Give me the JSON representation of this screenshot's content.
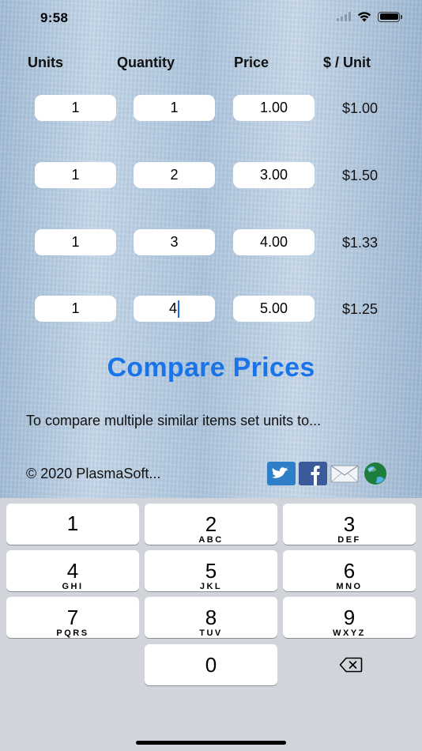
{
  "status_bar": {
    "time": "9:58"
  },
  "headers": {
    "units": "Units",
    "quantity": "Quantity",
    "price": "Price",
    "per_unit": "$ / Unit"
  },
  "rows": [
    {
      "units": "1",
      "quantity": "1",
      "price": "1.00",
      "per_unit": "$1.00"
    },
    {
      "units": "1",
      "quantity": "2",
      "price": "3.00",
      "per_unit": "$1.50"
    },
    {
      "units": "1",
      "quantity": "3",
      "price": "4.00",
      "per_unit": "$1.33"
    },
    {
      "units": "1",
      "quantity": "4",
      "price": "5.00",
      "per_unit": "$1.25"
    }
  ],
  "compare_button": "Compare Prices",
  "hint": "To compare multiple similar items set units to...",
  "copyright": "© 2020 PlasmaSoft...",
  "social": [
    "twitter-icon",
    "facebook-icon",
    "email-icon",
    "globe-icon"
  ],
  "keyboard": {
    "keys": [
      {
        "num": "1",
        "letters": ""
      },
      {
        "num": "2",
        "letters": "ABC"
      },
      {
        "num": "3",
        "letters": "DEF"
      },
      {
        "num": "4",
        "letters": "GHI"
      },
      {
        "num": "5",
        "letters": "JKL"
      },
      {
        "num": "6",
        "letters": "MNO"
      },
      {
        "num": "7",
        "letters": "PQRS"
      },
      {
        "num": "8",
        "letters": "TUV"
      },
      {
        "num": "9",
        "letters": "WXYZ"
      },
      {
        "num": "0",
        "letters": ""
      }
    ]
  },
  "colors": {
    "accent": "#1a74e8",
    "keyboard_bg": "#d1d4db",
    "caret": "#1a6ae6"
  }
}
